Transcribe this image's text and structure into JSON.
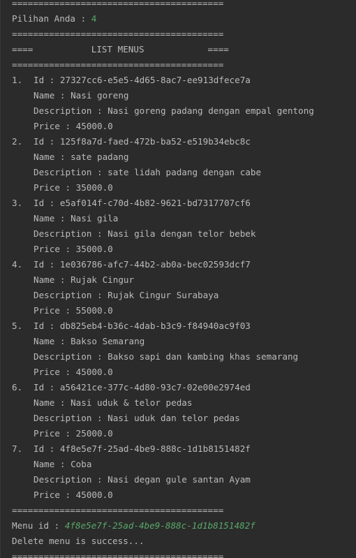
{
  "separator": "========================================",
  "prompt": {
    "label": "Pilihan Anda : ",
    "input": "4"
  },
  "list_header": "====           LIST MENUS            ====",
  "id_label": "Id : ",
  "name_label": "Name : ",
  "description_label": "Description : ",
  "price_label": "Price : ",
  "menus": [
    {
      "num": "1.",
      "id": "27327cc6-e5e5-4d65-8ac7-ee913dfece7a",
      "name": "Nasi goreng",
      "description": "Nasi goreng padang dengan empal gentong",
      "price": "45000.0"
    },
    {
      "num": "2.",
      "id": "125f8a7d-faed-472b-ba52-e519b34ebc8c",
      "name": "sate padang",
      "description": "sate lidah padang dengan cabe",
      "price": "35000.0"
    },
    {
      "num": "3.",
      "id": "e5af014f-c70d-4b82-9621-bd7317707cf6",
      "name": "Nasi gila",
      "description": "Nasi gila dengan telor bebek",
      "price": "35000.0"
    },
    {
      "num": "4.",
      "id": "1e036786-afc7-44b2-ab0a-bec02593dcf7",
      "name": "Rujak Cingur",
      "description": "Rujak Cingur Surabaya",
      "price": "55000.0"
    },
    {
      "num": "5.",
      "id": "db825eb4-b36c-4dab-b3c9-f84940ac9f03",
      "name": "Bakso Semarang",
      "description": "Bakso sapi dan kambing khas semarang",
      "price": "45000.0"
    },
    {
      "num": "6.",
      "id": "a56421ce-377c-4d80-93c7-02e00e2974ed",
      "name": "Nasi uduk & telor pedas",
      "description": "Nasi uduk dan telor pedas",
      "price": "25000.0"
    },
    {
      "num": "7.",
      "id": "4f8e5e7f-25ad-4be9-888c-1d1b8151482f",
      "name": "Coba",
      "description": "Nasi degan gule santan Ayam",
      "price": "45000.0"
    }
  ],
  "menu_id_prompt": {
    "label": "Menu id : ",
    "input": "4f8e5e7f-25ad-4be9-888c-1d1b8151482f"
  },
  "result_message": "Delete menu is success...",
  "colors": {
    "background": "#2b2b2b",
    "text": "#bbbbbb",
    "user_input": "#59a869"
  }
}
